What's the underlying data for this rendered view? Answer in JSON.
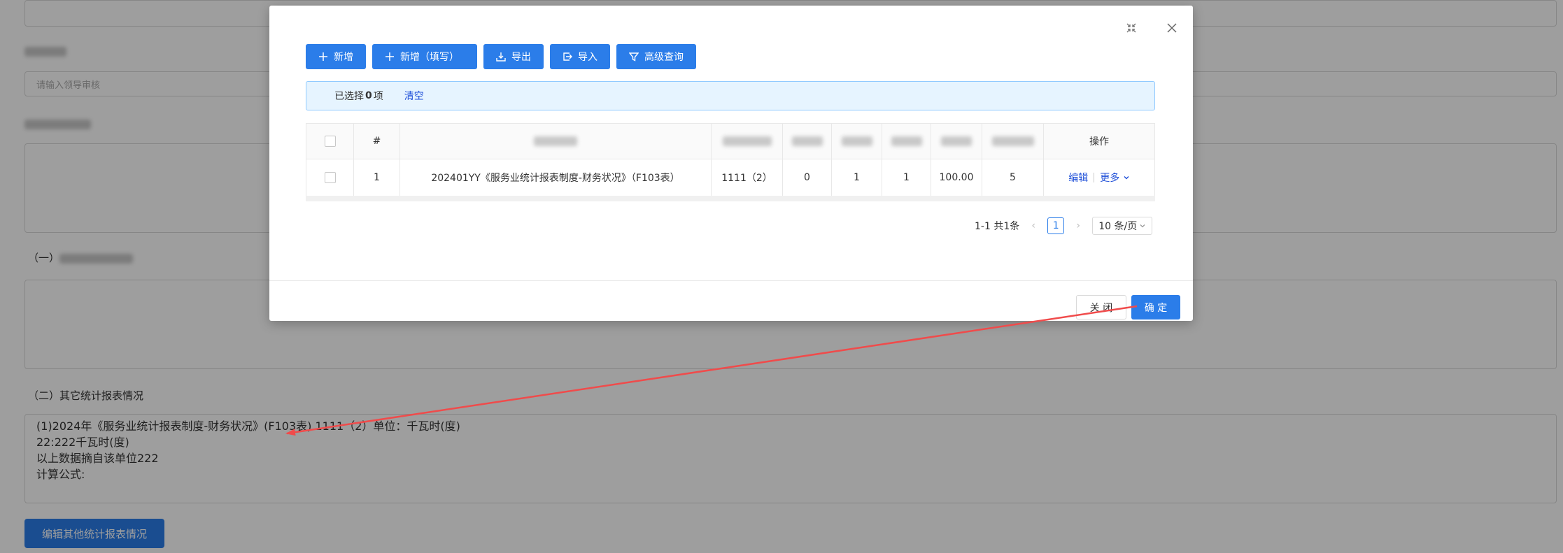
{
  "background": {
    "field1_placeholder": "请输入领导审核",
    "section2_prefix": "（一）",
    "section3_title": "（二）其它统计报表情况",
    "report_text": "(1)2024年《服务业统计报表制度-财务状况》(F103表) 1111（2）单位：千瓦时(度)\n22:222千瓦时(度)\n以上数据摘自该单位222\n计算公式:",
    "edit_button": "编辑其他统计报表情况"
  },
  "modal": {
    "toolbar": {
      "add": "新增",
      "add_fill": "新增（填写）",
      "export": "导出",
      "import": "导入",
      "advanced_query": "高级查询"
    },
    "alert": {
      "selected_prefix": "已选择",
      "selected_count": "0",
      "selected_suffix": "项",
      "clear": "清空"
    },
    "table": {
      "headers": {
        "index": "#",
        "ops": "操作"
      },
      "rows": [
        {
          "index": "1",
          "name": "202401YY《服务业统计报表制度-财务状况》（F103表）",
          "code": "1111（2）",
          "c3": "0",
          "c4": "1",
          "c5": "1",
          "c6": "100.00",
          "c7": "5",
          "edit": "编辑",
          "more": "更多"
        }
      ]
    },
    "pagination": {
      "summary": "1-1 共1条",
      "current": "1",
      "page_size": "10 条/页"
    },
    "footer": {
      "close": "关 闭",
      "ok": "确 定"
    }
  },
  "colors": {
    "primary": "#2b7de9",
    "arrow": "#f04b4b"
  }
}
